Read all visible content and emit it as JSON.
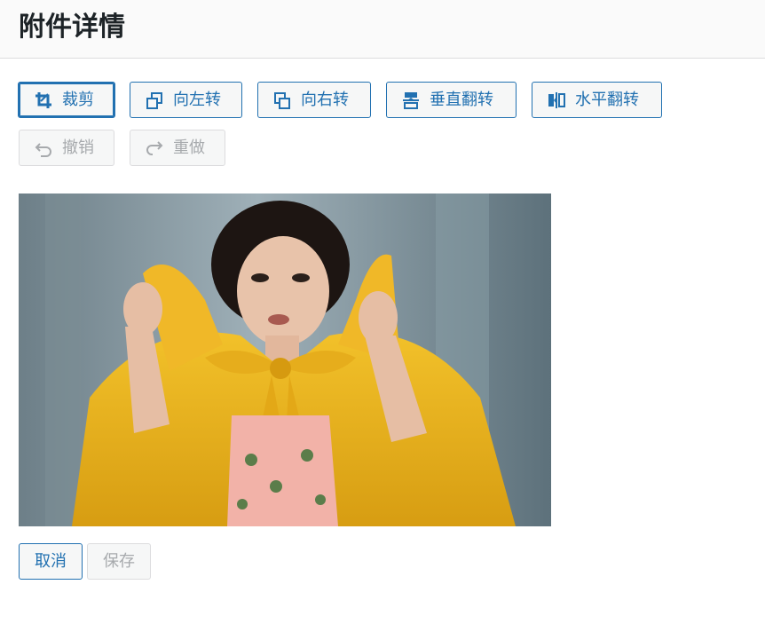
{
  "page": {
    "title": "附件详情"
  },
  "toolbar": {
    "crop": {
      "label": "裁剪",
      "icon": "crop-icon"
    },
    "rotate_left": {
      "label": "向左转",
      "icon": "rotate-left-icon"
    },
    "rotate_right": {
      "label": "向右转",
      "icon": "rotate-right-icon"
    },
    "flip_vertical": {
      "label": "垂直翻转",
      "icon": "flip-vertical-icon"
    },
    "flip_horizontal": {
      "label": "水平翻转",
      "icon": "flip-horizontal-icon"
    },
    "undo": {
      "label": "撤销",
      "icon": "undo-icon"
    },
    "redo": {
      "label": "重做",
      "icon": "redo-icon"
    }
  },
  "footer": {
    "cancel_label": "取消",
    "save_label": "保存"
  },
  "colors": {
    "accent": "#2271b1",
    "disabled": "#a7aaad",
    "header_bg": "#fafafa"
  }
}
